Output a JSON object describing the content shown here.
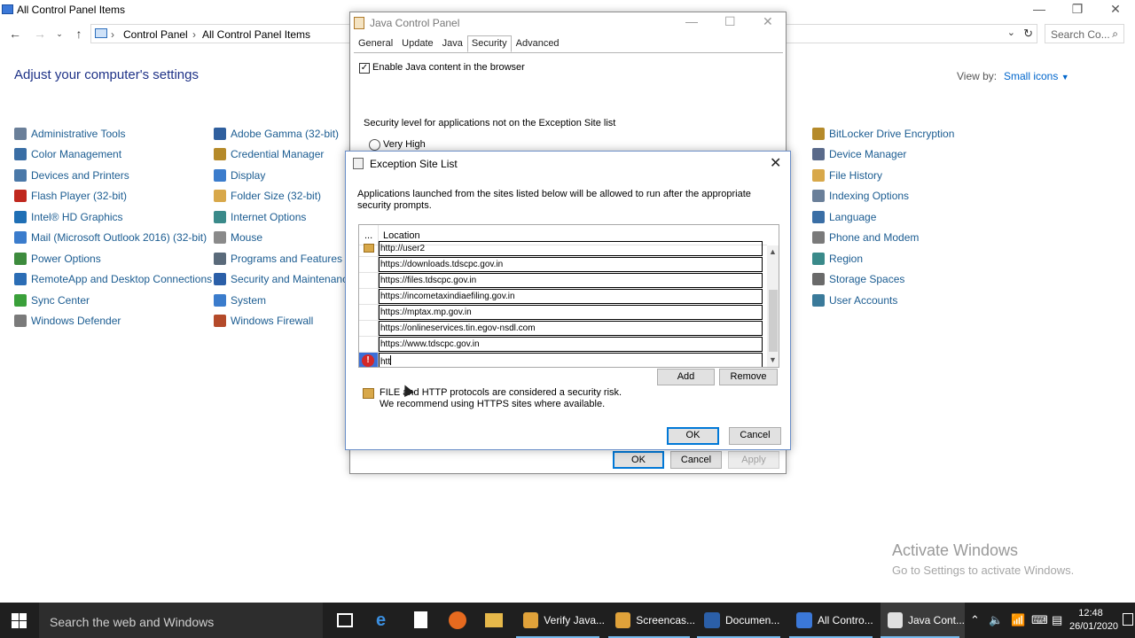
{
  "control_panel": {
    "window_title": "All Control Panel Items",
    "breadcrumb": [
      "Control Panel",
      "All Control Panel Items"
    ],
    "search_placeholder": "Search Co...",
    "heading": "Adjust your computer's settings",
    "view_by_label": "View by:",
    "view_by_value": "Small icons",
    "columns": [
      [
        {
          "label": "Administrative Tools",
          "icon": "admin-tools-icon",
          "color": "#6a7f99"
        },
        {
          "label": "Color Management",
          "icon": "color-management-icon",
          "color": "#3a6ea5"
        },
        {
          "label": "Devices and Printers",
          "icon": "devices-printers-icon",
          "color": "#4a78a8"
        },
        {
          "label": "Flash Player (32-bit)",
          "icon": "flash-player-icon",
          "color": "#c0281e"
        },
        {
          "label": "Intel® HD Graphics",
          "icon": "intel-graphics-icon",
          "color": "#1f6fb5"
        },
        {
          "label": "Mail (Microsoft Outlook 2016) (32-bit)",
          "icon": "mail-icon",
          "color": "#3b7ccc"
        },
        {
          "label": "Power Options",
          "icon": "power-options-icon",
          "color": "#3d8b3d"
        },
        {
          "label": "RemoteApp and Desktop Connections",
          "icon": "remoteapp-icon",
          "color": "#2b6db5"
        },
        {
          "label": "Sync Center",
          "icon": "sync-center-icon",
          "color": "#3aa03a"
        },
        {
          "label": "Windows Defender",
          "icon": "windows-defender-icon",
          "color": "#7a7a7a"
        }
      ],
      [
        {
          "label": "Adobe Gamma (32-bit)",
          "icon": "adobe-gamma-icon",
          "color": "#2f5f9e"
        },
        {
          "label": "Credential Manager",
          "icon": "credential-manager-icon",
          "color": "#b58a2a"
        },
        {
          "label": "Display",
          "icon": "display-icon",
          "color": "#3b7ccc"
        },
        {
          "label": "Folder Size (32-bit)",
          "icon": "folder-size-icon",
          "color": "#d8a84a"
        },
        {
          "label": "Internet Options",
          "icon": "internet-options-icon",
          "color": "#3a8a8a"
        },
        {
          "label": "Mouse",
          "icon": "mouse-icon",
          "color": "#8a8a8a"
        },
        {
          "label": "Programs and Features",
          "icon": "programs-features-icon",
          "color": "#5a6a7a"
        },
        {
          "label": "Security and Maintenance",
          "icon": "security-maintenance-icon",
          "color": "#2b5fa8"
        },
        {
          "label": "System",
          "icon": "system-icon",
          "color": "#3b7ccc"
        },
        {
          "label": "Windows Firewall",
          "icon": "windows-firewall-icon",
          "color": "#b44a2a"
        }
      ],
      [
        {
          "label": "BitLocker Drive Encryption",
          "icon": "bitlocker-icon",
          "color": "#b58a2a"
        },
        {
          "label": "Device Manager",
          "icon": "device-manager-icon",
          "color": "#5a6a8a"
        },
        {
          "label": "File History",
          "icon": "file-history-icon",
          "color": "#d8a84a"
        },
        {
          "label": "Indexing Options",
          "icon": "indexing-options-icon",
          "color": "#6a7f99"
        },
        {
          "label": "Language",
          "icon": "language-icon",
          "color": "#3a6ea5"
        },
        {
          "label": "Phone and Modem",
          "icon": "phone-modem-icon",
          "color": "#7a7a7a"
        },
        {
          "label": "Region",
          "icon": "region-icon",
          "color": "#3a8a8a"
        },
        {
          "label": "Storage Spaces",
          "icon": "storage-spaces-icon",
          "color": "#6a6a6a"
        },
        {
          "label": "User Accounts",
          "icon": "user-accounts-icon",
          "color": "#3a7a9a"
        }
      ]
    ]
  },
  "java_control_panel": {
    "title": "Java Control Panel",
    "tabs": [
      "General",
      "Update",
      "Java",
      "Security",
      "Advanced"
    ],
    "active_tab": "Security",
    "enable_java_label": "Enable Java content in the browser",
    "enable_java_checked": true,
    "security_level_label": "Security level for applications not on the Exception Site list",
    "radio_very_high": "Very High",
    "ok": "OK",
    "cancel": "Cancel",
    "apply": "Apply"
  },
  "exception_site_list": {
    "title": "Exception Site List",
    "description": "Applications launched from the sites listed below will be allowed to run after the appropriate security prompts.",
    "col_icon": "...",
    "col_location": "Location",
    "rows": [
      {
        "location": "http://user2",
        "icon": "lock-icon"
      },
      {
        "location": "https://downloads.tdscpc.gov.in",
        "icon": ""
      },
      {
        "location": "https://files.tdscpc.gov.in",
        "icon": ""
      },
      {
        "location": "https://incometaxindiaefiling.gov.in",
        "icon": ""
      },
      {
        "location": "https://mptax.mp.gov.in",
        "icon": ""
      },
      {
        "location": "https://onlineservices.tin.egov-nsdl.com",
        "icon": ""
      },
      {
        "location": "https://www.tdscpc.gov.in",
        "icon": ""
      }
    ],
    "editing_value": "htt",
    "add": "Add",
    "remove": "Remove",
    "warning_line1": "FILE and HTTP protocols are considered a security risk.",
    "warning_line2": "We recommend using HTTPS sites where available.",
    "ok": "OK",
    "cancel": "Cancel"
  },
  "watermark": {
    "line1": "Activate Windows",
    "line2": "Go to Settings to activate Windows."
  },
  "taskbar": {
    "search_placeholder": "Search the web and Windows",
    "apps": [
      {
        "label": "Verify Java...",
        "icon": "chrome-icon",
        "color": "#e0a23a"
      },
      {
        "label": "Screencas...",
        "icon": "chrome-icon",
        "color": "#e0a23a"
      },
      {
        "label": "Documen...",
        "icon": "word-icon",
        "color": "#2b5fa8"
      },
      {
        "label": "All Contro...",
        "icon": "control-panel-icon",
        "color": "#3b78d8"
      },
      {
        "label": "Java Cont...",
        "icon": "java-icon",
        "color": "#e0e0e0"
      }
    ],
    "time": "12:48",
    "date": "26/01/2020"
  }
}
